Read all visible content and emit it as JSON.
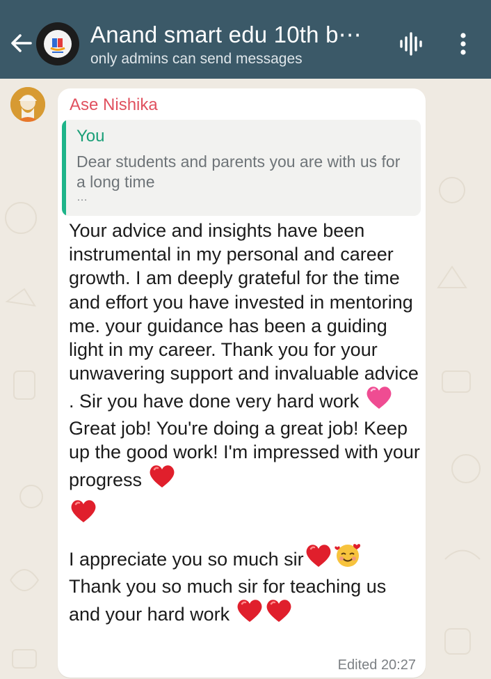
{
  "header": {
    "back_icon": "arrow-left-icon",
    "group_title": "Anand smart edu 10th b⋯",
    "status": "only admins can send messages",
    "voice_icon": "voice-waveform-icon",
    "menu_icon": "more-vertical-icon"
  },
  "message": {
    "sender": "Ase Nishika",
    "quoted_author": "You",
    "quoted_text": "Dear students and parents you are with us for a long time",
    "quoted_more": "…",
    "body_1": "Your advice and insights have been instrumental in my personal and career growth. I am deeply grateful for the time and effort you have invested in mentoring me. your guidance has been a guiding light in my career. Thank you for your unwavering support and invaluable advice . Sir you have done very hard work ",
    "body_2": "Great job! You're doing a great job! Keep up the good work! I'm impressed with your progress ",
    "body_3": "I appreciate you so much sir",
    "body_4": "Thank you so much sir for teaching us and your hard work ",
    "footer": "Edited 20:27"
  },
  "colors": {
    "header_bg": "#3b5968",
    "sender_name": "#e0515f",
    "quote_accent": "#1eb489",
    "bubble_bg": "#ffffff",
    "wallpaper": "#efeae2"
  }
}
